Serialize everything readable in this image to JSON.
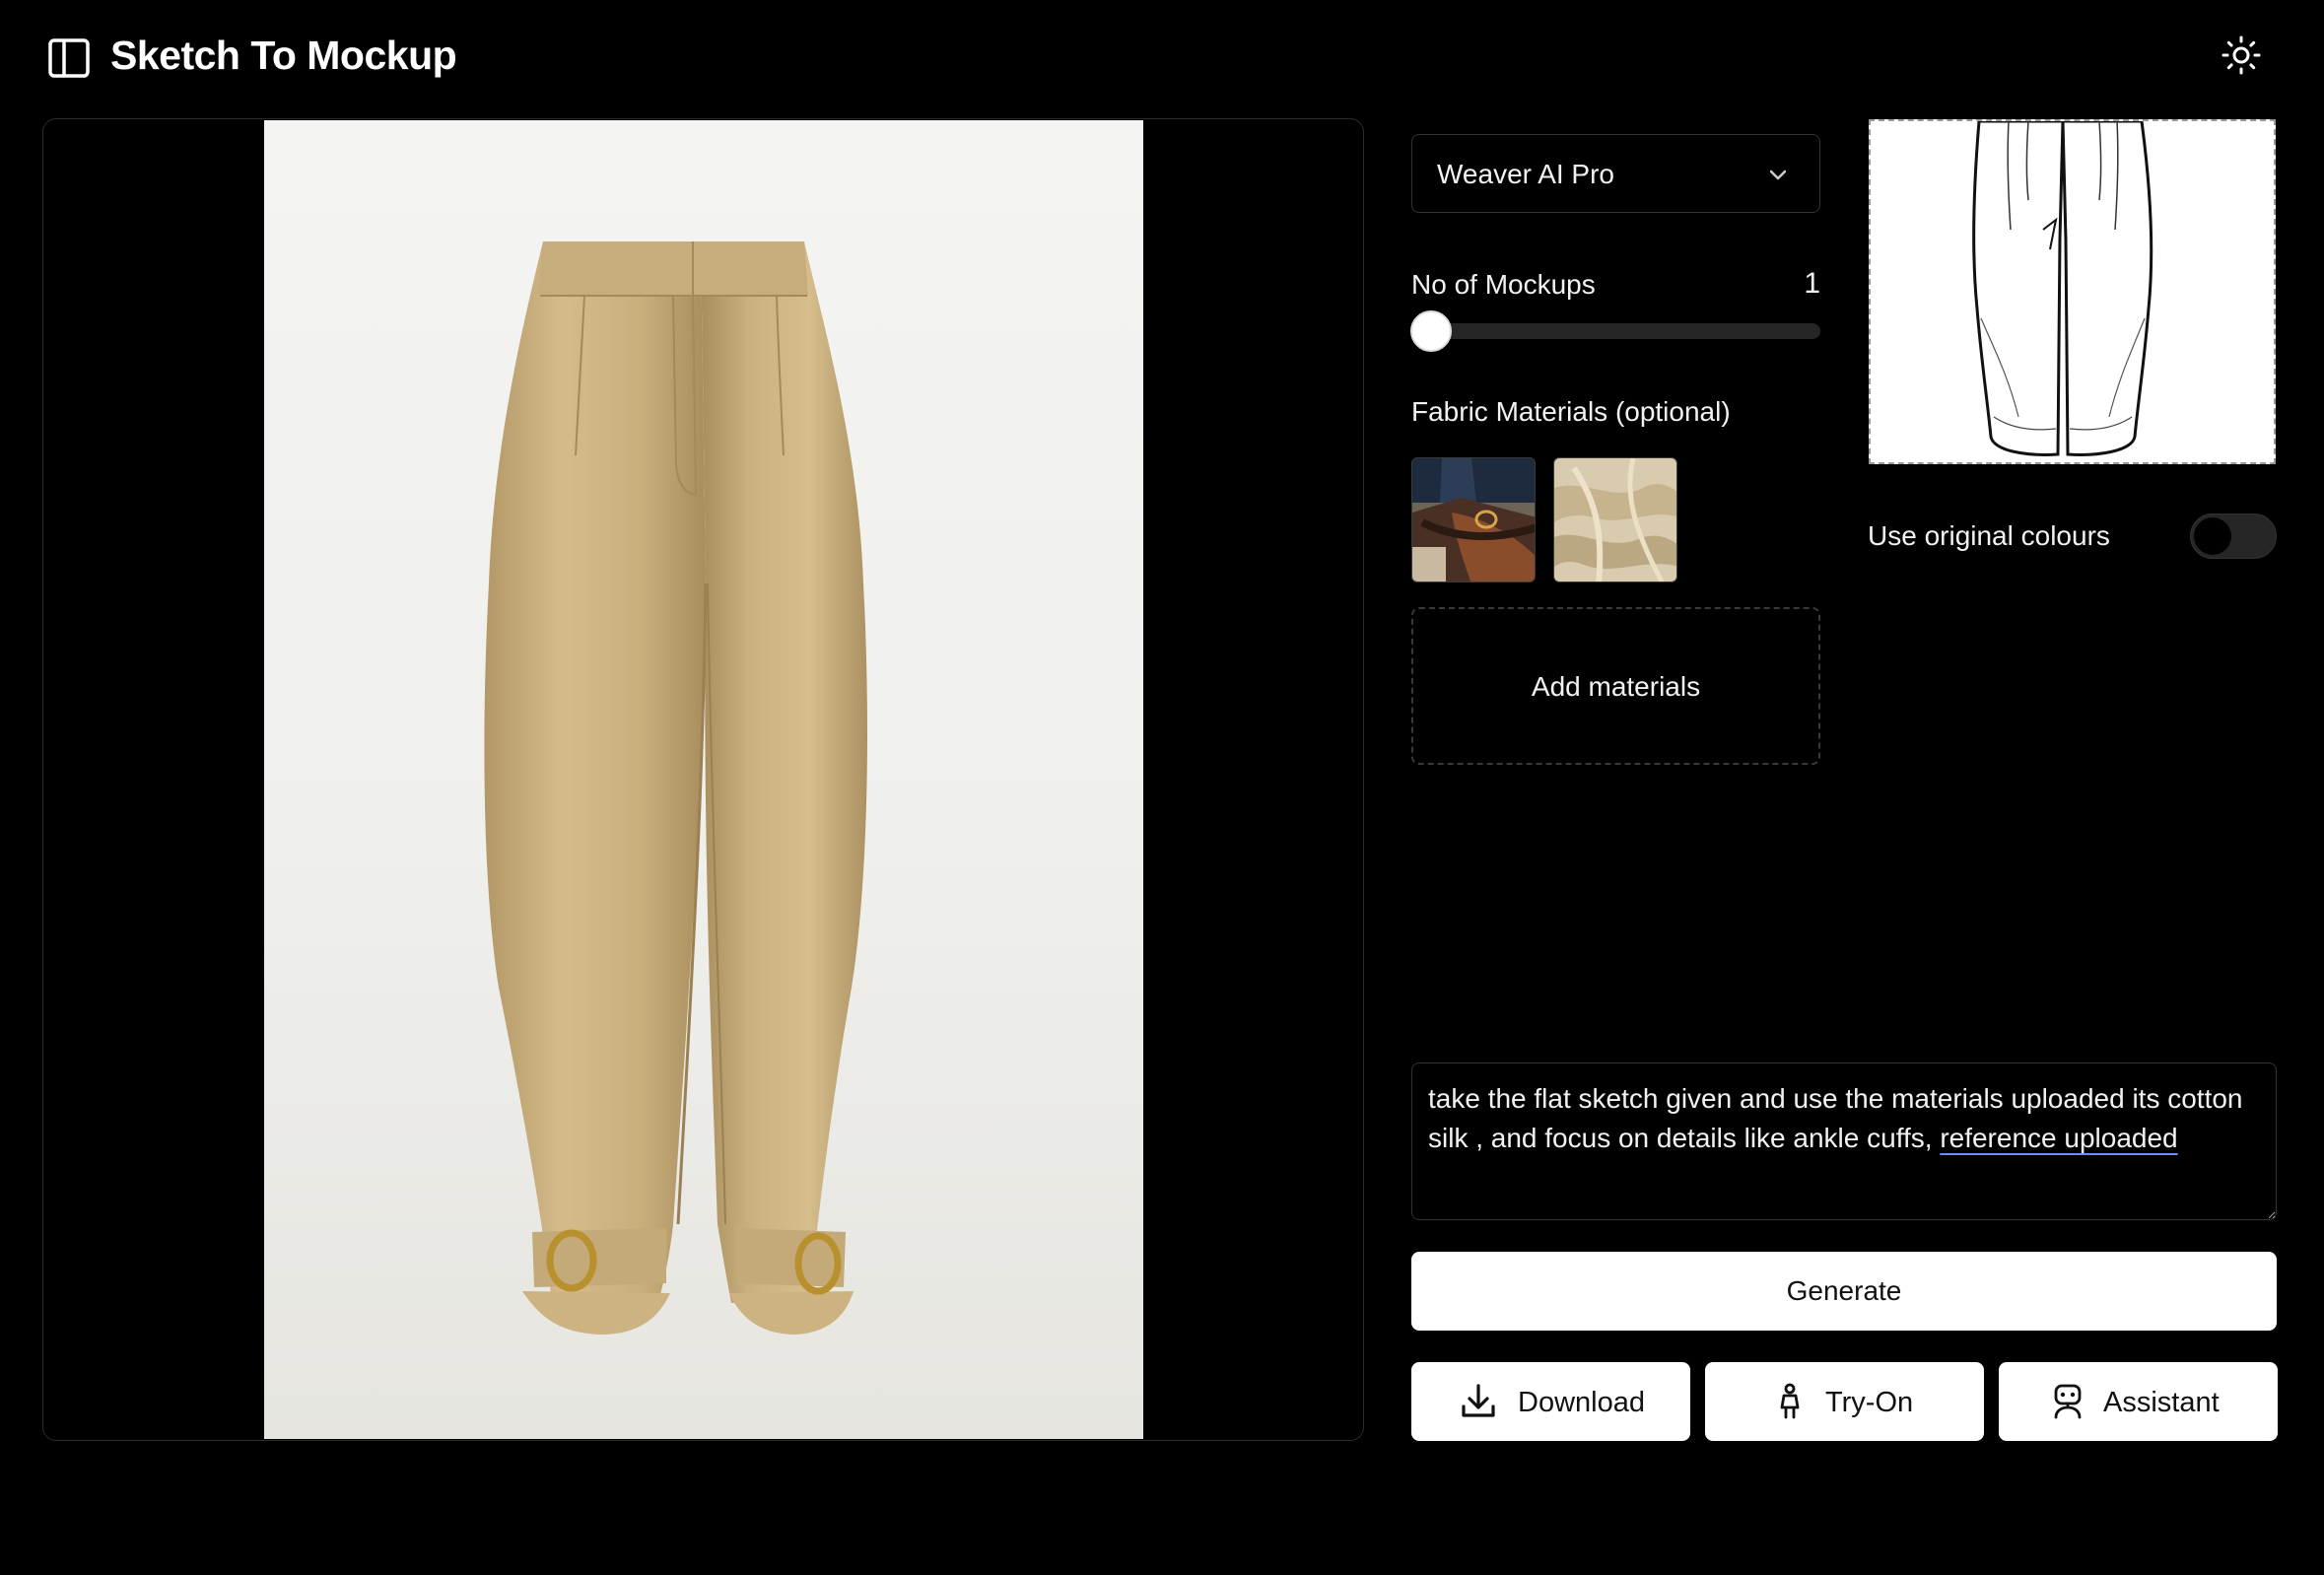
{
  "app": {
    "title": "Sketch To Mockup"
  },
  "controls": {
    "model": {
      "selected": "Weaver AI Pro"
    },
    "mockups": {
      "label": "No of Mockups",
      "value": "1",
      "slider_min": 1,
      "slider_max": 4
    },
    "fabric": {
      "label": "Fabric Materials (optional)",
      "materials": [
        "denim-leather-swatch",
        "cotton-silk-swatch"
      ],
      "add_label": "Add materials"
    },
    "original_colours": {
      "label": "Use original colours",
      "enabled": false
    }
  },
  "prompt": {
    "text_before": "take the flat sketch given and use the materials uploaded its cotton silk , and focus on details like ankle cuffs, ",
    "text_flagged": "reference uploaded"
  },
  "actions": {
    "generate": "Generate",
    "download": "Download",
    "try_on": "Try-On",
    "assistant": "Assistant"
  },
  "icons": {
    "sidebar": "sidebar-panel-icon",
    "theme": "sun-icon",
    "select": "chevron-down-icon",
    "download": "download-icon",
    "try_on": "person-icon",
    "assistant": "robot-icon"
  },
  "colors": {
    "background": "#000000",
    "button": "#ffffff",
    "garment": "#c8ae7e",
    "spellcheck": "#6c8cff"
  }
}
